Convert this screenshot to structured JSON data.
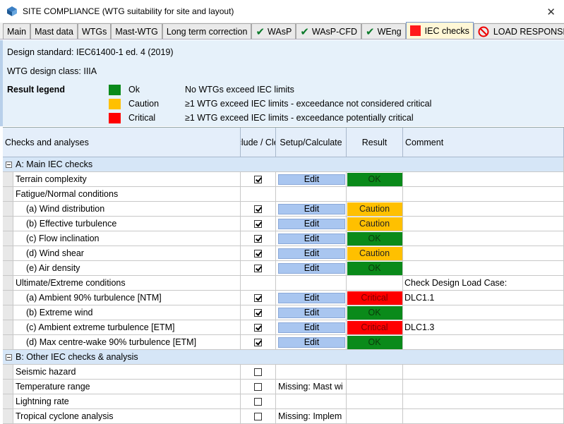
{
  "window": {
    "title": "SITE COMPLIANCE (WTG suitability for site and layout)",
    "close_glyph": "✕"
  },
  "tabs": [
    {
      "label": "Main",
      "check": false
    },
    {
      "label": "Mast data",
      "check": false
    },
    {
      "label": "WTGs",
      "check": false
    },
    {
      "label": "Mast-WTG",
      "check": false
    },
    {
      "label": "Long term correction",
      "check": false
    },
    {
      "label": "WAsP",
      "check": true
    },
    {
      "label": "WAsP-CFD",
      "check": true
    },
    {
      "label": "WEng",
      "check": true
    },
    {
      "label": "IEC checks",
      "active": true,
      "icon": "red-square-icon"
    },
    {
      "label": "LOAD RESPONSE",
      "icon": "no-entry-icon"
    }
  ],
  "info": {
    "design_standard": "Design standard: IEC61400-1 ed. 4 (2019)",
    "design_class": "WTG design class: IIIA",
    "legend_title": "Result legend",
    "legend": [
      {
        "name": "Ok",
        "color": "#0a8a1a",
        "desc": "No WTGs exceed IEC limits"
      },
      {
        "name": "Caution",
        "color": "#ffc000",
        "desc": "≥1 WTG exceed IEC limits - exceedance not considered critical"
      },
      {
        "name": "Critical",
        "color": "#ff0000",
        "desc": "≥1 WTG exceed IEC limits - exceedance potentially critical"
      }
    ]
  },
  "grid": {
    "headers": {
      "checks": "Checks and analyses",
      "include": "Include / Clear",
      "setup": "Setup/Calculate",
      "result": "Result",
      "comment": "Comment"
    },
    "edit_label": "Edit",
    "result_labels": {
      "ok": "OK",
      "caution": "Caution",
      "critical": "Critical"
    },
    "sections": {
      "a": "A: Main IEC checks",
      "b": "B: Other IEC checks & analysis"
    },
    "rows": {
      "terrain": {
        "label": "Terrain complexity",
        "comment": ""
      },
      "fatigue": {
        "label": "Fatigue/Normal conditions"
      },
      "wind_dist": {
        "label": "(a) Wind distribution"
      },
      "eff_turb": {
        "label": "(b) Effective turbulence"
      },
      "flow_incl": {
        "label": "(c) Flow inclination"
      },
      "wind_shear": {
        "label": "(d) Wind shear"
      },
      "air_density": {
        "label": "(e) Air density"
      },
      "ultimate": {
        "label": "Ultimate/Extreme conditions",
        "comment": "Check Design Load Case:"
      },
      "amb90": {
        "label": "(a) Ambient 90% turbulence [NTM]",
        "comment": "DLC1.1"
      },
      "ext_wind": {
        "label": "(b) Extreme wind"
      },
      "amb_ext": {
        "label": "(c) Ambient extreme turbulence [ETM]",
        "comment": "DLC1.3"
      },
      "max_wake": {
        "label": "(d) Max centre-wake 90% turbulence [ETM]"
      },
      "seismic": {
        "label": "Seismic hazard"
      },
      "temperature": {
        "label": "Temperature range",
        "setup": "Missing: Mast wi"
      },
      "lightning": {
        "label": "Lightning rate"
      },
      "tropical": {
        "label": "Tropical cyclone analysis",
        "setup": "Missing: Implem"
      }
    }
  }
}
